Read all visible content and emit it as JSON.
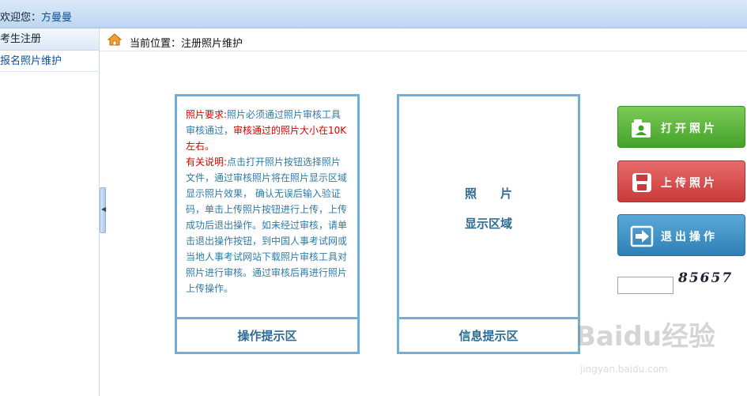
{
  "header": {
    "welcome_prefix": "欢迎您：",
    "user_name": "方曼曼"
  },
  "sidebar": {
    "section_title": "考生注册",
    "items": [
      {
        "label": "报名照片维护"
      }
    ]
  },
  "breadcrumb": {
    "text": "当前位置：注册照片维护"
  },
  "tip_panel": {
    "req_title": "照片要求:",
    "req_text": "照片必须通过照片审核工具审核通过，",
    "req_red": "审核通过的照片大小在10K左右。",
    "note_title": "有关说明:",
    "note_text": "点击打开照片按钮选择照片文件，通过审核照片将在照片显示区域显示照片效果， 确认无误后输入验证码，单击上传照片按钮进行上传，上传成功后退出操作。如未经过审核，请单击退出操作按钮，到中国人事考试网或当地人事考试网站下载照片审核工具对照片进行审核。通过审核后再进行照片上传操作。",
    "footer": "操作提示区"
  },
  "info_panel": {
    "photo_line1": "照　　片",
    "photo_line2": "显示区域",
    "footer": "信息提示区"
  },
  "buttons": {
    "open": "打开照片",
    "upload": "上传照片",
    "exit": "退出操作"
  },
  "captcha": {
    "input_value": "",
    "code": "85657"
  },
  "watermark": {
    "brand": "Baidu经验",
    "url": "jingyan.baidu.com"
  },
  "colors": {
    "panel_border": "#6fb0d8",
    "open_button": "#4caf34",
    "upload_button": "#d44545",
    "exit_button": "#3a8cc0",
    "highlight_red": "#d40000"
  }
}
